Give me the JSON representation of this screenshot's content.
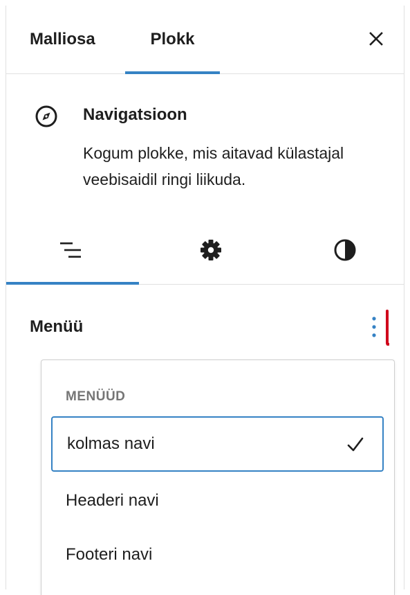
{
  "header": {
    "tabs": [
      {
        "label": "Malliosa",
        "active": false
      },
      {
        "label": "Plokk",
        "active": true
      }
    ],
    "close_icon": "close-icon"
  },
  "block": {
    "icon": "compass-icon",
    "title": "Navigatsioon",
    "description": "Kogum plokke, mis aitavad külastajal veebisaidil ringi liikuda."
  },
  "inner_tabs": [
    {
      "icon": "list-view-icon",
      "active": true
    },
    {
      "icon": "gear-icon",
      "active": false
    },
    {
      "icon": "contrast-icon",
      "active": false
    }
  ],
  "menu": {
    "label": "Menüü",
    "more_icon": "vertical-ellipsis-icon",
    "dropdown": {
      "group_label": "MENÜÜD",
      "items": [
        {
          "label": "kolmas navi",
          "selected": true
        },
        {
          "label": "Headeri navi",
          "selected": false
        },
        {
          "label": "Footeri navi",
          "selected": false
        }
      ]
    }
  },
  "colors": {
    "accent": "#3582c4",
    "annotation": "#d0021b",
    "text": "#1e1e1e",
    "muted": "#757575"
  }
}
